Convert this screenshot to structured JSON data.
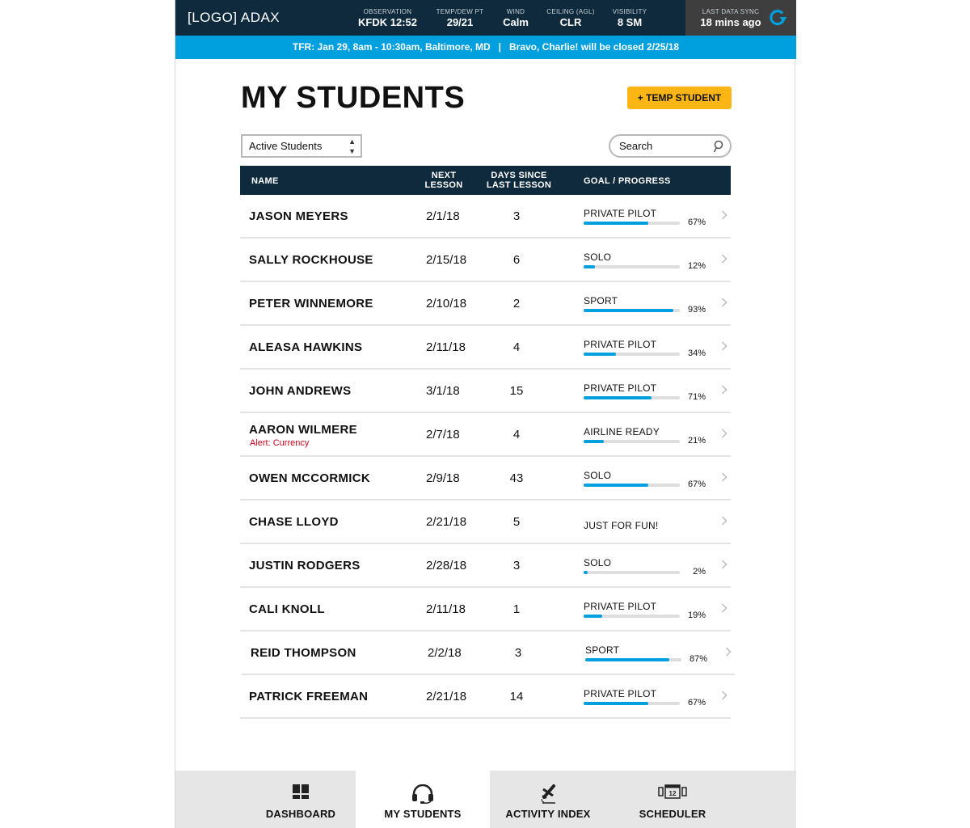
{
  "app": {
    "logo": "[LOGO] ADAX"
  },
  "weather": [
    {
      "label": "OBSERVATION",
      "value": "KFDK 12:52"
    },
    {
      "label": "TEMP/DEW PT",
      "value": "29/21"
    },
    {
      "label": "WIND",
      "value": "Calm"
    },
    {
      "label": "CEILING (AGL)",
      "value": "CLR"
    },
    {
      "label": "VISIBILITY",
      "value": "8 SM"
    }
  ],
  "sync": {
    "label": "LAST DATA SYNC",
    "value": "18 mins ago",
    "icon": "refresh-icon"
  },
  "banner": {
    "tfr": "TFR: Jan 29, 8am - 10:30am, Baltimore, MD",
    "separator": "|",
    "notice": "Bravo, Charlie! will be closed 2/25/18"
  },
  "page": {
    "title": "MY STUDENTS",
    "temp_student_button": "+ TEMP STUDENT",
    "filter": {
      "selected": "Active Students"
    },
    "search": {
      "placeholder": "Search",
      "value": ""
    }
  },
  "table": {
    "headers": {
      "name": "NAME",
      "next_lesson_1": "NEXT",
      "next_lesson_2": "LESSON",
      "days_since_1": "DAYS SINCE",
      "days_since_2": "LAST LESSON",
      "goal": "GOAL / PROGRESS"
    },
    "rows": [
      {
        "name": "JASON MEYERS",
        "alert": "",
        "next_lesson": "2/1/18",
        "days_since": "3",
        "goal": "PRIVATE PILOT",
        "progress": 67,
        "progress_label": "67%"
      },
      {
        "name": "SALLY ROCKHOUSE",
        "alert": "",
        "next_lesson": "2/15/18",
        "days_since": "6",
        "goal": "SOLO",
        "progress": 12,
        "progress_label": "12%"
      },
      {
        "name": "PETER WINNEMORE",
        "alert": "",
        "next_lesson": "2/10/18",
        "days_since": "2",
        "goal": "SPORT",
        "progress": 93,
        "progress_label": "93%"
      },
      {
        "name": "ALEASA HAWKINS",
        "alert": "",
        "next_lesson": "2/11/18",
        "days_since": "4",
        "goal": "PRIVATE PILOT",
        "progress": 34,
        "progress_label": "34%"
      },
      {
        "name": "JOHN ANDREWS",
        "alert": "",
        "next_lesson": "3/1/18",
        "days_since": "15",
        "goal": "PRIVATE PILOT",
        "progress": 71,
        "progress_label": "71%"
      },
      {
        "name": "AARON WILMERE",
        "alert": "Alert: Currency",
        "next_lesson": "2/7/18",
        "days_since": "4",
        "goal": "AIRLINE READY",
        "progress": 21,
        "progress_label": "21%"
      },
      {
        "name": "OWEN MCCORMICK",
        "alert": "",
        "next_lesson": "2/9/18",
        "days_since": "43",
        "goal": "SOLO",
        "progress": 67,
        "progress_label": "67%"
      },
      {
        "name": "CHASE LLOYD",
        "alert": "",
        "next_lesson": "2/21/18",
        "days_since": "5",
        "goal": "JUST FOR FUN!",
        "progress": null,
        "progress_label": ""
      },
      {
        "name": "JUSTIN RODGERS",
        "alert": "",
        "next_lesson": "2/28/18",
        "days_since": "3",
        "goal": "SOLO",
        "progress": 2,
        "progress_label": "2%"
      },
      {
        "name": "CALI KNOLL",
        "alert": "",
        "next_lesson": "2/11/18",
        "days_since": "1",
        "goal": "PRIVATE PILOT",
        "progress": 19,
        "progress_label": "19%"
      },
      {
        "name": "REID THOMPSON",
        "alert": "",
        "next_lesson": "2/2/18",
        "days_since": "3",
        "goal": "SPORT",
        "progress": 87,
        "progress_label": "87%"
      },
      {
        "name": "PATRICK FREEMAN",
        "alert": "",
        "next_lesson": "2/21/18",
        "days_since": "14",
        "goal": "PRIVATE PILOT",
        "progress": 67,
        "progress_label": "67%"
      }
    ]
  },
  "colors": {
    "navy": "#0e2a3c",
    "accent_blue": "#009fde",
    "button_yellow": "#fbb615",
    "alert_red": "#d0021b",
    "sync_grey": "#3e3e3e"
  },
  "bottom_nav": [
    {
      "label": "DASHBOARD",
      "icon": "dashboard-icon",
      "active": false
    },
    {
      "label": "MY STUDENTS",
      "icon": "headset-icon",
      "active": true
    },
    {
      "label": "ACTIVITY INDEX",
      "icon": "airplane-icon",
      "active": false
    },
    {
      "label": "SCHEDULER",
      "icon": "calendar-icon",
      "active": false
    }
  ]
}
